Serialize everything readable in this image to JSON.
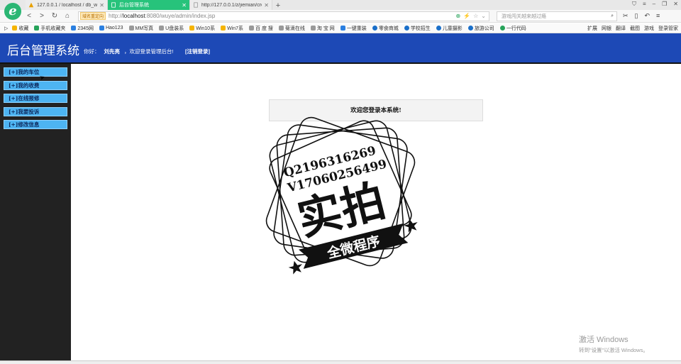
{
  "browser": {
    "tabs": [
      {
        "title": "127.0.0.1 / localhost / db_wuye",
        "active": false,
        "color": "#e8a000"
      },
      {
        "title": "后台管理系统",
        "active": true,
        "color": "#ffffff"
      },
      {
        "title": "http://127.0.0.1/z/jiemian/cre",
        "active": false,
        "color": "#999999"
      }
    ],
    "redirect_tag": "域名重定向",
    "url_host": "localhost",
    "url_rest": ":8080/wuye/admin/index.jsp",
    "url_prefix": "http://",
    "search_placeholder": "游戏闯关越来越过瘾",
    "bookmarks": [
      {
        "label": "收藏",
        "color": "#f5b400"
      },
      {
        "label": "手机收藏夹",
        "color": "#27a35a"
      },
      {
        "label": "2345网",
        "color": "#2b7fe0"
      },
      {
        "label": "Hao123",
        "color": "#2b7fe0"
      },
      {
        "label": "MM写真",
        "color": "#999999"
      },
      {
        "label": "U盘装系",
        "color": "#999999"
      },
      {
        "label": "Win10系",
        "color": "#f5b400"
      },
      {
        "label": "Win7系",
        "color": "#f5b400"
      },
      {
        "label": "百 度 搜",
        "color": "#999999"
      },
      {
        "label": "菊滴在线",
        "color": "#999999"
      },
      {
        "label": "淘 宝 网",
        "color": "#999999"
      },
      {
        "label": "一键重装",
        "color": "#2b7fe0"
      },
      {
        "label": "零食商城",
        "color": "#1a6fc9"
      },
      {
        "label": "学校招生",
        "color": "#1a6fc9"
      },
      {
        "label": "儿童摄影",
        "color": "#1a6fc9"
      },
      {
        "label": "旅游公司",
        "color": "#1a6fc9"
      },
      {
        "label": "一行代码",
        "color": "#27a35a"
      }
    ],
    "bookmarks_right": [
      "扩展",
      "网银",
      "翻译",
      "截图",
      "游戏",
      "登录管家"
    ]
  },
  "header": {
    "site_title": "后台管理系统",
    "greeting_prefix": "你好：",
    "user_name": "刘先亮",
    "greeting_suffix": "，欢迎登录管理后台!",
    "logout": "[注销登录]",
    "bg_color": "#1d49b6"
  },
  "sidebar": {
    "items": [
      {
        "label": "[+]我的车位"
      },
      {
        "label": "[+]我的收费"
      },
      {
        "label": "[+]在线报修"
      },
      {
        "label": "[+]我要投诉"
      },
      {
        "label": "[+]修改信息"
      }
    ]
  },
  "main": {
    "welcome": "欢迎您登录本系统!"
  },
  "stamp": {
    "line1": "Q2196316269",
    "line2": "V17060256499",
    "big_text": "实拍",
    "ribbon_text": "全微程序"
  },
  "os_watermark": {
    "line1": "激活 Windows",
    "line2": "转到\"设置\"以激活 Windows。"
  }
}
